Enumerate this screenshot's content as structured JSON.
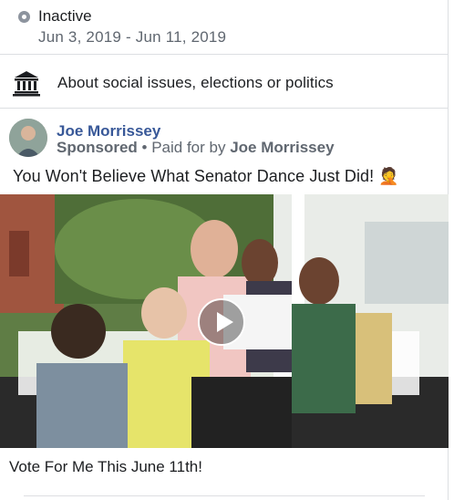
{
  "status": {
    "label": "Inactive",
    "date_range": "Jun 3, 2019 - Jun 11, 2019"
  },
  "category": {
    "label": "About social issues, elections or politics",
    "icon": "bank-icon"
  },
  "ad": {
    "advertiser": "Joe Morrissey",
    "sponsored_label": "Sponsored",
    "separator": " • ",
    "paid_for_prefix": "Paid for by ",
    "paid_for_name": "Joe Morrissey",
    "body_text": "You Won't Believe What Senator Dance Just Did! 🤦",
    "caption": "Vote For Me This June 11th!"
  },
  "colors": {
    "link": "#385898",
    "secondary_text": "#606770",
    "divider": "#dddfe2"
  }
}
